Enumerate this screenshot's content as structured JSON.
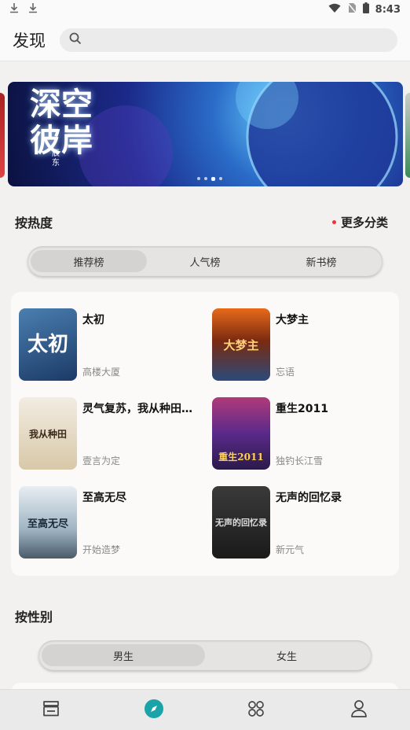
{
  "status_bar": {
    "time": "8:43"
  },
  "header": {
    "title": "发现",
    "search_placeholder": ""
  },
  "banner": {
    "title": "深空彼岸",
    "author": "辰东",
    "dots": 4,
    "active_dot": 2
  },
  "hot_section": {
    "title": "按热度",
    "more_label": "更多分类",
    "tabs": [
      {
        "label": "推荐榜",
        "active": true
      },
      {
        "label": "人气榜",
        "active": false
      },
      {
        "label": "新书榜",
        "active": false
      }
    ],
    "books": [
      {
        "title": "太初",
        "author": "高楼大厦",
        "cover_text": "太初"
      },
      {
        "title": "大梦主",
        "author": "忘语",
        "cover_text": "大梦主"
      },
      {
        "title": "灵气复苏，我从种田…",
        "author": "壹言为定",
        "cover_text": "我从种田"
      },
      {
        "title": "重生2011",
        "author": "独钓长江雪",
        "cover_text": "重生2011"
      },
      {
        "title": "至高无尽",
        "author": "开始造梦",
        "cover_text": "至高无尽"
      },
      {
        "title": "无声的回忆录",
        "author": "新元气",
        "cover_text": "无声的回忆录"
      }
    ]
  },
  "gender_section": {
    "title": "按性别",
    "tabs": [
      {
        "label": "男生",
        "active": true
      },
      {
        "label": "女生",
        "active": false
      }
    ]
  },
  "bottom_nav": [
    {
      "name": "bookshelf",
      "active": false
    },
    {
      "name": "discover",
      "active": true
    },
    {
      "name": "category",
      "active": false
    },
    {
      "name": "profile",
      "active": false
    }
  ],
  "colors": {
    "accent": "#1aa3a8",
    "red_dot": "#e33333"
  }
}
